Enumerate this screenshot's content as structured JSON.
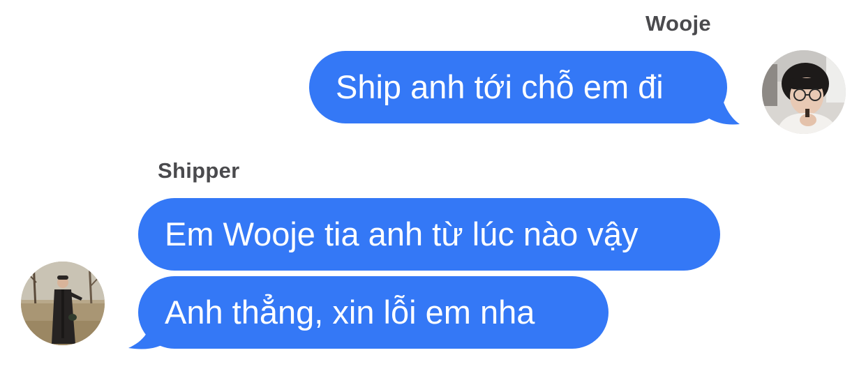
{
  "conversation": {
    "outgoing": {
      "sender_name": "Wooje",
      "messages": [
        "Ship anh tới chỗ em đi"
      ]
    },
    "incoming": {
      "sender_name": "Shipper",
      "messages": [
        "Em Wooje tia anh từ lúc nào vậy",
        "Anh thẳng, xin lỗi em nha"
      ]
    }
  },
  "colors": {
    "bubble": "#3478f6",
    "bubble_text": "#ffffff",
    "sender_name": "#4a4a4d",
    "background": "#ffffff"
  }
}
